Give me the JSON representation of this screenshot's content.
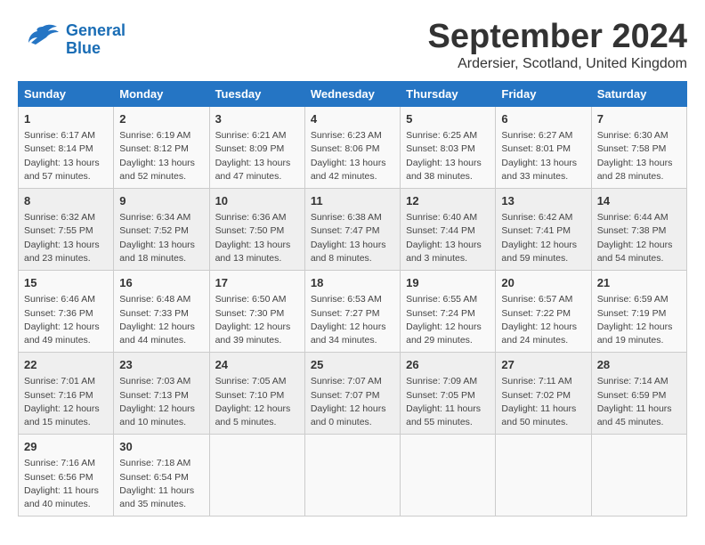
{
  "logo": {
    "line1": "General",
    "line2": "Blue"
  },
  "title": "September 2024",
  "subtitle": "Ardersier, Scotland, United Kingdom",
  "headers": [
    "Sunday",
    "Monday",
    "Tuesday",
    "Wednesday",
    "Thursday",
    "Friday",
    "Saturday"
  ],
  "rows": [
    [
      {
        "day": "1",
        "info": "Sunrise: 6:17 AM\nSunset: 8:14 PM\nDaylight: 13 hours and 57 minutes."
      },
      {
        "day": "2",
        "info": "Sunrise: 6:19 AM\nSunset: 8:12 PM\nDaylight: 13 hours and 52 minutes."
      },
      {
        "day": "3",
        "info": "Sunrise: 6:21 AM\nSunset: 8:09 PM\nDaylight: 13 hours and 47 minutes."
      },
      {
        "day": "4",
        "info": "Sunrise: 6:23 AM\nSunset: 8:06 PM\nDaylight: 13 hours and 42 minutes."
      },
      {
        "day": "5",
        "info": "Sunrise: 6:25 AM\nSunset: 8:03 PM\nDaylight: 13 hours and 38 minutes."
      },
      {
        "day": "6",
        "info": "Sunrise: 6:27 AM\nSunset: 8:01 PM\nDaylight: 13 hours and 33 minutes."
      },
      {
        "day": "7",
        "info": "Sunrise: 6:30 AM\nSunset: 7:58 PM\nDaylight: 13 hours and 28 minutes."
      }
    ],
    [
      {
        "day": "8",
        "info": "Sunrise: 6:32 AM\nSunset: 7:55 PM\nDaylight: 13 hours and 23 minutes."
      },
      {
        "day": "9",
        "info": "Sunrise: 6:34 AM\nSunset: 7:52 PM\nDaylight: 13 hours and 18 minutes."
      },
      {
        "day": "10",
        "info": "Sunrise: 6:36 AM\nSunset: 7:50 PM\nDaylight: 13 hours and 13 minutes."
      },
      {
        "day": "11",
        "info": "Sunrise: 6:38 AM\nSunset: 7:47 PM\nDaylight: 13 hours and 8 minutes."
      },
      {
        "day": "12",
        "info": "Sunrise: 6:40 AM\nSunset: 7:44 PM\nDaylight: 13 hours and 3 minutes."
      },
      {
        "day": "13",
        "info": "Sunrise: 6:42 AM\nSunset: 7:41 PM\nDaylight: 12 hours and 59 minutes."
      },
      {
        "day": "14",
        "info": "Sunrise: 6:44 AM\nSunset: 7:38 PM\nDaylight: 12 hours and 54 minutes."
      }
    ],
    [
      {
        "day": "15",
        "info": "Sunrise: 6:46 AM\nSunset: 7:36 PM\nDaylight: 12 hours and 49 minutes."
      },
      {
        "day": "16",
        "info": "Sunrise: 6:48 AM\nSunset: 7:33 PM\nDaylight: 12 hours and 44 minutes."
      },
      {
        "day": "17",
        "info": "Sunrise: 6:50 AM\nSunset: 7:30 PM\nDaylight: 12 hours and 39 minutes."
      },
      {
        "day": "18",
        "info": "Sunrise: 6:53 AM\nSunset: 7:27 PM\nDaylight: 12 hours and 34 minutes."
      },
      {
        "day": "19",
        "info": "Sunrise: 6:55 AM\nSunset: 7:24 PM\nDaylight: 12 hours and 29 minutes."
      },
      {
        "day": "20",
        "info": "Sunrise: 6:57 AM\nSunset: 7:22 PM\nDaylight: 12 hours and 24 minutes."
      },
      {
        "day": "21",
        "info": "Sunrise: 6:59 AM\nSunset: 7:19 PM\nDaylight: 12 hours and 19 minutes."
      }
    ],
    [
      {
        "day": "22",
        "info": "Sunrise: 7:01 AM\nSunset: 7:16 PM\nDaylight: 12 hours and 15 minutes."
      },
      {
        "day": "23",
        "info": "Sunrise: 7:03 AM\nSunset: 7:13 PM\nDaylight: 12 hours and 10 minutes."
      },
      {
        "day": "24",
        "info": "Sunrise: 7:05 AM\nSunset: 7:10 PM\nDaylight: 12 hours and 5 minutes."
      },
      {
        "day": "25",
        "info": "Sunrise: 7:07 AM\nSunset: 7:07 PM\nDaylight: 12 hours and 0 minutes."
      },
      {
        "day": "26",
        "info": "Sunrise: 7:09 AM\nSunset: 7:05 PM\nDaylight: 11 hours and 55 minutes."
      },
      {
        "day": "27",
        "info": "Sunrise: 7:11 AM\nSunset: 7:02 PM\nDaylight: 11 hours and 50 minutes."
      },
      {
        "day": "28",
        "info": "Sunrise: 7:14 AM\nSunset: 6:59 PM\nDaylight: 11 hours and 45 minutes."
      }
    ],
    [
      {
        "day": "29",
        "info": "Sunrise: 7:16 AM\nSunset: 6:56 PM\nDaylight: 11 hours and 40 minutes."
      },
      {
        "day": "30",
        "info": "Sunrise: 7:18 AM\nSunset: 6:54 PM\nDaylight: 11 hours and 35 minutes."
      },
      {
        "day": "",
        "info": ""
      },
      {
        "day": "",
        "info": ""
      },
      {
        "day": "",
        "info": ""
      },
      {
        "day": "",
        "info": ""
      },
      {
        "day": "",
        "info": ""
      }
    ]
  ]
}
